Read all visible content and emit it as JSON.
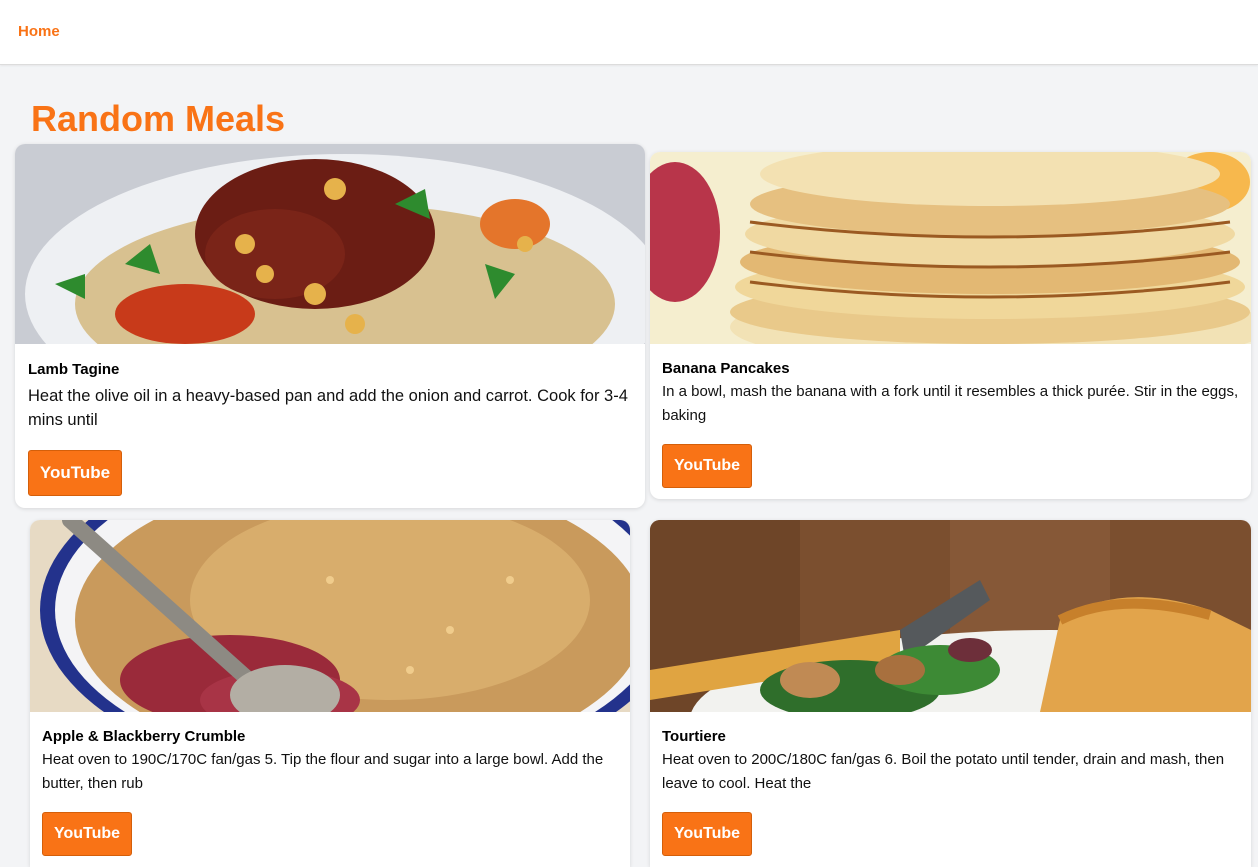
{
  "nav": {
    "home_label": "Home"
  },
  "page": {
    "title": "Random Meals"
  },
  "colors": {
    "accent": "#f97316",
    "background": "#f3f4f6"
  },
  "meals": [
    {
      "title": "Lamb Tagine",
      "description": "Heat the olive oil in a heavy-based pan and add the onion and carrot. Cook for 3-4 mins until",
      "button_label": "YouTube",
      "image": "lamb-tagine-photo"
    },
    {
      "title": "Banana Pancakes",
      "description": "In a bowl, mash the banana with a fork until it resembles a thick purée. Stir in the eggs, baking",
      "button_label": "YouTube",
      "image": "banana-pancakes-photo"
    },
    {
      "title": "Apple & Blackberry Crumble",
      "description": "Heat oven to 190C/170C fan/gas 5. Tip the flour and sugar into a large bowl. Add the butter, then rub",
      "button_label": "YouTube",
      "image": "apple-blackberry-crumble-photo"
    },
    {
      "title": "Tourtiere",
      "description": "Heat oven to 200C/180C fan/gas 6. Boil the potato until tender, drain and mash, then leave to cool. Heat the",
      "button_label": "YouTube",
      "image": "tourtiere-photo"
    }
  ]
}
